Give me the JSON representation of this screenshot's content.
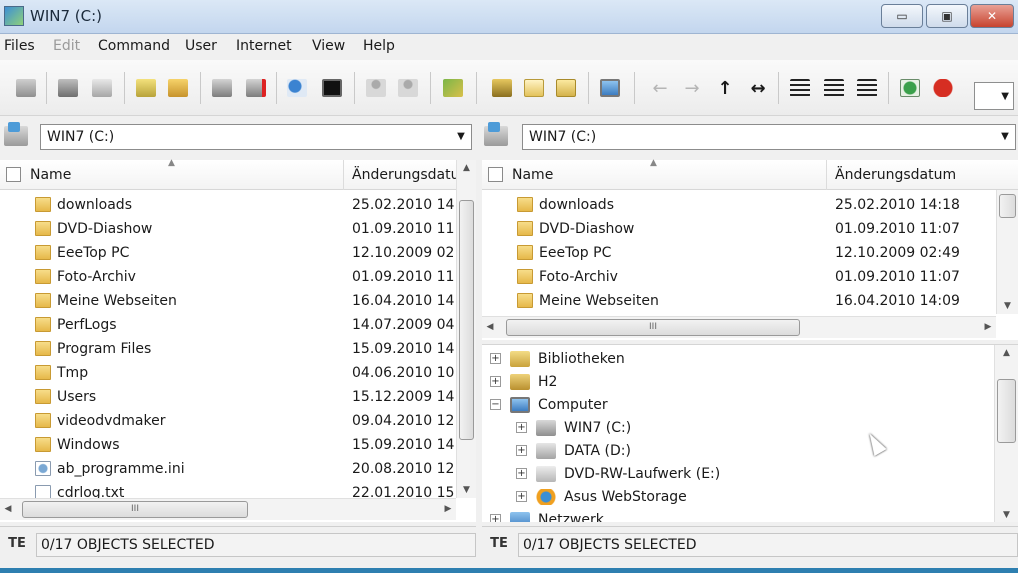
{
  "window": {
    "title": "WIN7 (C:)",
    "minimize": "▭",
    "maximize": "▣",
    "close": "✕"
  },
  "menu": [
    "Files",
    "Edit",
    "Command",
    "User",
    "Internet",
    "View",
    "Help"
  ],
  "toolbar": {
    "icons": [
      "copy-files-icon",
      "print-icon",
      "cut-icon",
      "new-file-icon",
      "new-folder-icon",
      "network-drive-icon",
      "disconnect-drive-icon",
      "search-icon",
      "terminal-icon",
      "user-icon",
      "user-up-icon",
      "edit-icon",
      "pack-icon",
      "mail-icon",
      "envelope-icon",
      "computer-icon",
      "arrow-left-icon",
      "arrow-right-icon",
      "arrow-up-icon",
      "arrow-swap-icon",
      "sort-up-icon",
      "sort-right-icon",
      "sort-list-icon",
      "refresh-icon",
      "cancel-icon"
    ],
    "nav": {
      "left": "←",
      "right": "→",
      "up": "↑",
      "swap": "↔"
    }
  },
  "left_panel": {
    "drive": "WIN7 (C:)",
    "columns": {
      "name": "Name",
      "date": "Änderungsdatum"
    },
    "rows": [
      {
        "name": "downloads",
        "date": "25.02.2010 14",
        "type": "folder"
      },
      {
        "name": "DVD-Diashow",
        "date": "01.09.2010 11",
        "type": "folder"
      },
      {
        "name": "EeeTop PC",
        "date": "12.10.2009 02",
        "type": "folder"
      },
      {
        "name": "Foto-Archiv",
        "date": "01.09.2010 11",
        "type": "folder"
      },
      {
        "name": "Meine Webseiten",
        "date": "16.04.2010 14",
        "type": "folder"
      },
      {
        "name": "PerfLogs",
        "date": "14.07.2009 04",
        "type": "folder"
      },
      {
        "name": "Program Files",
        "date": "15.09.2010 14",
        "type": "folder"
      },
      {
        "name": "Tmp",
        "date": "04.06.2010 10",
        "type": "folder"
      },
      {
        "name": "Users",
        "date": "15.12.2009 14",
        "type": "folder"
      },
      {
        "name": "videodvdmaker",
        "date": "09.04.2010 12",
        "type": "folder"
      },
      {
        "name": "Windows",
        "date": "15.09.2010 14",
        "type": "folder"
      },
      {
        "name": "ab_programme.ini",
        "date": "20.08.2010 12",
        "type": "ini"
      },
      {
        "name": "cdrlog.txt",
        "date": "22.01.2010 15",
        "type": "file"
      }
    ],
    "status": "0/17 OBJECTS SELECTED"
  },
  "right_panel": {
    "drive": "WIN7 (C:)",
    "columns": {
      "name": "Name",
      "date": "Änderungsdatum"
    },
    "rows": [
      {
        "name": "downloads",
        "date": "25.02.2010 14:18"
      },
      {
        "name": "DVD-Diashow",
        "date": "01.09.2010 11:07"
      },
      {
        "name": "EeeTop PC",
        "date": "12.10.2009 02:49"
      },
      {
        "name": "Foto-Archiv",
        "date": "01.09.2010 11:07"
      },
      {
        "name": "Meine Webseiten",
        "date": "16.04.2010 14:09"
      }
    ],
    "tree": [
      {
        "label": "Bibliotheken",
        "level": 0,
        "expander": "+",
        "icon": "library-icon",
        "color": "#e2c25a"
      },
      {
        "label": "H2",
        "level": 0,
        "expander": "+",
        "icon": "user-folder-icon",
        "color": "#d9b94e"
      },
      {
        "label": "Computer",
        "level": 0,
        "expander": "−",
        "icon": "computer-icon",
        "color": "#4d8fd0"
      },
      {
        "label": "WIN7 (C:)",
        "level": 1,
        "expander": "+",
        "icon": "system-drive-icon",
        "color": "#9aa3ad"
      },
      {
        "label": "DATA (D:)",
        "level": 1,
        "expander": "+",
        "icon": "drive-icon",
        "color": "#b9bec4"
      },
      {
        "label": "DVD-RW-Laufwerk (E:)",
        "level": 1,
        "expander": "+",
        "icon": "dvd-drive-icon",
        "color": "#c9cdd2"
      },
      {
        "label": "Asus WebStorage",
        "level": 1,
        "expander": "+",
        "icon": "cloud-storage-icon",
        "color": "#f0a020"
      },
      {
        "label": "Netzwerk",
        "level": 0,
        "expander": "+",
        "icon": "network-icon",
        "color": "#4d8fd0"
      }
    ],
    "status": "0/17 OBJECTS SELECTED"
  },
  "scroll_grip": "III",
  "status_icon": "TE"
}
